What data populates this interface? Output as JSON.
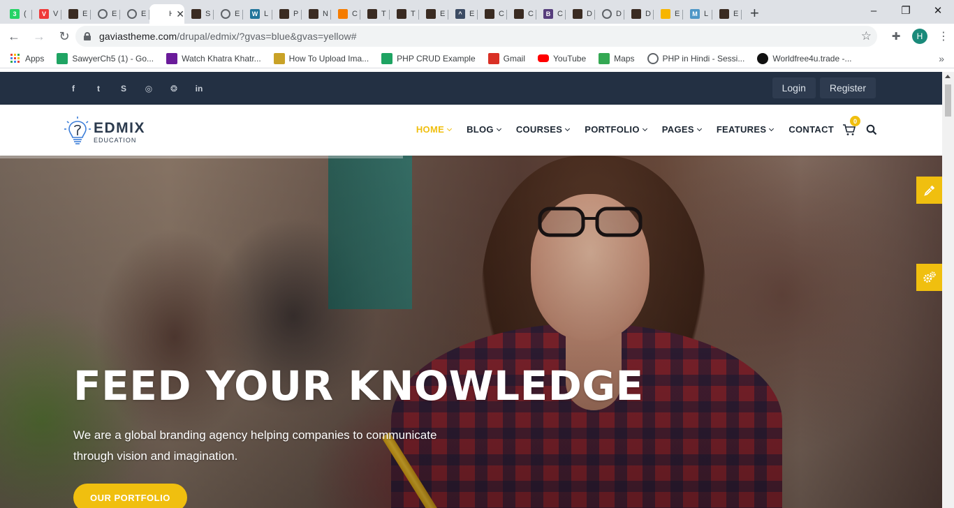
{
  "browser": {
    "tabs": [
      {
        "label": "(",
        "icon": "whatsapp-icon",
        "color": "#25d366",
        "glyph": "3"
      },
      {
        "label": "V",
        "icon": "vivaldi-icon",
        "color": "#ef3939",
        "glyph": "V"
      },
      {
        "label": "E",
        "icon": "edmix-icon",
        "color": "#3a2b22",
        "glyph": ""
      },
      {
        "label": "E",
        "icon": "globe-icon",
        "color": "#5f6368",
        "glyph": ""
      },
      {
        "label": "E",
        "icon": "globe-icon",
        "color": "#5f6368",
        "glyph": ""
      },
      {
        "label": "H",
        "icon": "page-icon",
        "color": "#ffffff",
        "glyph": "",
        "active": true
      },
      {
        "label": "S",
        "icon": "edmix-icon",
        "color": "#3a2b22",
        "glyph": ""
      },
      {
        "label": "E",
        "icon": "globe-icon",
        "color": "#5f6368",
        "glyph": ""
      },
      {
        "label": "L",
        "icon": "wordpress-icon",
        "color": "#21759b",
        "glyph": "W"
      },
      {
        "label": "P",
        "icon": "edmix-icon",
        "color": "#3a2b22",
        "glyph": ""
      },
      {
        "label": "N",
        "icon": "edmix-icon",
        "color": "#3a2b22",
        "glyph": ""
      },
      {
        "label": "C",
        "icon": "square-icon",
        "color": "#f57c00",
        "glyph": ""
      },
      {
        "label": "T",
        "icon": "edmix-icon",
        "color": "#3a2b22",
        "glyph": ""
      },
      {
        "label": "T",
        "icon": "edmix-icon",
        "color": "#3a2b22",
        "glyph": ""
      },
      {
        "label": "E",
        "icon": "edmix-icon",
        "color": "#3a2b22",
        "glyph": ""
      },
      {
        "label": "E",
        "icon": "graduation-cap-icon",
        "color": "#3c4b63",
        "glyph": "^"
      },
      {
        "label": "C",
        "icon": "edmix-icon",
        "color": "#3a2b22",
        "glyph": ""
      },
      {
        "label": "C",
        "icon": "edmix-icon",
        "color": "#3a2b22",
        "glyph": ""
      },
      {
        "label": "C",
        "icon": "bootstrap-icon",
        "color": "#563d7c",
        "glyph": "B"
      },
      {
        "label": "D",
        "icon": "edmix-icon",
        "color": "#3a2b22",
        "glyph": ""
      },
      {
        "label": "D",
        "icon": "globe-icon",
        "color": "#5f6368",
        "glyph": ""
      },
      {
        "label": "D",
        "icon": "edmix-icon",
        "color": "#3a2b22",
        "glyph": ""
      },
      {
        "label": "E",
        "icon": "sketch-icon",
        "color": "#f7b500",
        "glyph": ""
      },
      {
        "label": "L",
        "icon": "materialize-icon",
        "color": "#4e97c7",
        "glyph": "M"
      },
      {
        "label": "E",
        "icon": "edmix-icon",
        "color": "#3a2b22",
        "glyph": ""
      }
    ],
    "active_tab_label": "H",
    "url_host": "gaviastheme.com",
    "url_path": "/drupal/edmix/?gvas=blue&gvas=yellow#",
    "profile_initial": "H",
    "bookmarks": [
      {
        "label": "Apps",
        "icon": "apps-grid-icon",
        "color": ""
      },
      {
        "label": "SawyerCh5 (1) - Go...",
        "icon": "google-drive-icon",
        "color": "#1fa463"
      },
      {
        "label": "Watch Khatra Khatr...",
        "icon": "voot-icon",
        "color": "#6a1b9a"
      },
      {
        "label": "How To Upload Ima...",
        "icon": "b-icon",
        "color": "#c9a227"
      },
      {
        "label": "PHP CRUD Example",
        "icon": "s-icon",
        "color": "#1ea362"
      },
      {
        "label": "Gmail",
        "icon": "gmail-icon",
        "color": "#d93025"
      },
      {
        "label": "YouTube",
        "icon": "youtube-icon",
        "color": "#ff0000"
      },
      {
        "label": "Maps",
        "icon": "maps-icon",
        "color": "#34a853"
      },
      {
        "label": "PHP in Hindi - Sessi...",
        "icon": "globe-icon",
        "color": "#5f6368"
      },
      {
        "label": "Worldfree4u.trade -...",
        "icon": "g-icon",
        "color": "#111111"
      }
    ]
  },
  "site": {
    "social": [
      "facebook-icon",
      "twitter-icon",
      "skype-icon",
      "instagram-icon",
      "dribbble-icon",
      "linkedin-icon"
    ],
    "social_glyphs": [
      "f",
      "t",
      "S",
      "◎",
      "❂",
      "in"
    ],
    "login_label": "Login",
    "register_label": "Register",
    "logo_name": "EDMIX",
    "logo_sub": "EDUCATION",
    "menu": [
      {
        "label": "HOME",
        "caret": true,
        "active": true
      },
      {
        "label": "BLOG",
        "caret": true
      },
      {
        "label": "COURSES",
        "caret": true
      },
      {
        "label": "PORTFOLIO",
        "caret": true
      },
      {
        "label": "PAGES",
        "caret": true
      },
      {
        "label": "FEATURES",
        "caret": true
      },
      {
        "label": "CONTACT",
        "caret": false
      }
    ],
    "cart_count": "0",
    "accent": "#f0bf0f",
    "topbar_color": "#233043",
    "hero": {
      "title": "FEED YOUR KNOWLEDGE",
      "subtitle": "We are a global branding agency helping companies to communicate through vision and imagination.",
      "button": "OUR PORTFOLIO"
    }
  }
}
